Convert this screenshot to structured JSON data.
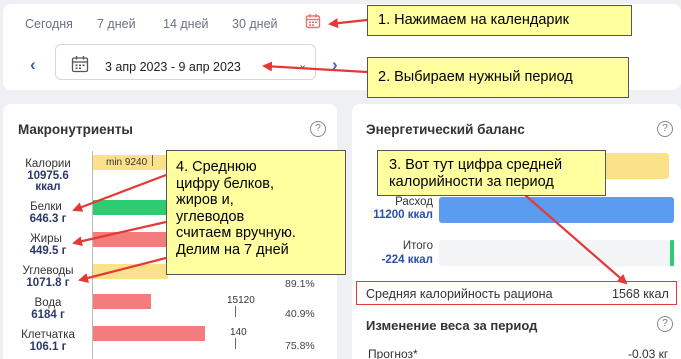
{
  "period_tabs": [
    "Сегодня",
    "7 дней",
    "14 дней",
    "30 дней"
  ],
  "date_range": "3 апр 2023 - 9 апр 2023",
  "macro": {
    "title": "Макронутриенты",
    "rows": [
      {
        "label": "Калории",
        "value": "10975.6 ккал",
        "value_line1": "10975.6",
        "value_line2": "ккал"
      },
      {
        "label": "Белки",
        "value": "646.3 г"
      },
      {
        "label": "Жиры",
        "value": "449.5 г"
      },
      {
        "label": "Углеводы",
        "value": "1071.8 г"
      },
      {
        "label": "Вода",
        "value": "6184 г"
      },
      {
        "label": "Клетчатка",
        "value": "106.1 г"
      }
    ],
    "calorie_min": "min 9240",
    "water_target": "15120",
    "water_pct": "40.9%",
    "fiber_target": "140",
    "fiber_pct": "75.8%",
    "carbs_pct_partial": "89.1%"
  },
  "energy": {
    "title": "Энергетический баланс",
    "expense_label": "Расход",
    "expense_value": "11200 ккал",
    "total_label": "Итого",
    "total_value": "-224 ккал",
    "avg_label": "Средняя калорийность рациона",
    "avg_value": "1568 ккал",
    "weight_title": "Изменение веса за период",
    "forecast_label": "Прогноз*",
    "forecast_value": "-0.03 кг"
  },
  "callouts": {
    "c1": "1. Нажимаем на календарик",
    "c2": "2. Выбираем нужный период",
    "c3": [
      "3. Вот тут цифра средней",
      "калорийности за период"
    ],
    "c4": [
      "4. Среднюю",
      "цифру белков,",
      "жиров и,",
      "углеводов",
      "считаем вручную.",
      "Делим на 7 дней"
    ]
  },
  "colors": {
    "accent": "#3b5fc0",
    "bar_yellow": "#fbe28a",
    "bar_green": "#2ecc71",
    "bar_red": "#f47c7c",
    "bar_blue": "#5b9bf0",
    "annotation_red": "#e53935",
    "callout_bg": "#ffffa0"
  },
  "icons": [
    "calendar-icon",
    "chevron-left-icon",
    "chevron-right-icon",
    "chevron-down-icon",
    "help-icon"
  ]
}
